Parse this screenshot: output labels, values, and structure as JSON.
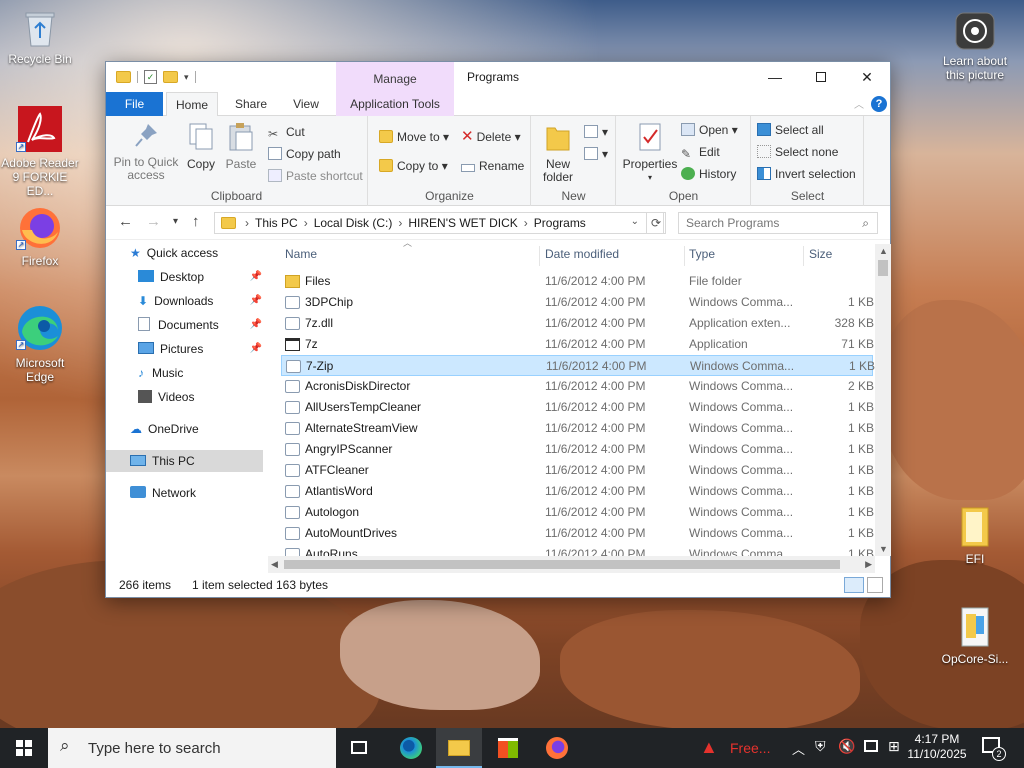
{
  "desktop": {
    "icons_left": [
      {
        "label": "Recycle Bin",
        "icon": "recycle-bin-icon"
      },
      {
        "label": "Adobe Reader 9 FORKIE ED...",
        "icon": "adobe-reader-icon"
      },
      {
        "label": "Firefox",
        "icon": "firefox-icon"
      },
      {
        "label": "Microsoft Edge",
        "icon": "edge-icon"
      }
    ],
    "icons_right": [
      {
        "label": "Learn about this picture",
        "icon": "camera-icon"
      },
      {
        "label": "EFI",
        "icon": "folder-icon"
      },
      {
        "label": "OpCore-Si...",
        "icon": "file-icon"
      }
    ]
  },
  "window": {
    "title": "Programs",
    "context_tab": "Manage",
    "ribbon_tabs": [
      "File",
      "Home",
      "Share",
      "View",
      "Application Tools"
    ],
    "ribbon": {
      "clipboard": {
        "label": "Clipboard",
        "pin": "Pin to Quick access",
        "copy": "Copy",
        "paste": "Paste",
        "cut": "Cut",
        "copy_path": "Copy path",
        "paste_shortcut": "Paste shortcut"
      },
      "organize": {
        "label": "Organize",
        "move_to": "Move to",
        "copy_to": "Copy to",
        "delete": "Delete",
        "rename": "Rename"
      },
      "new": {
        "label": "New",
        "new_folder": "New folder"
      },
      "open": {
        "label": "Open",
        "properties": "Properties",
        "open": "Open",
        "edit": "Edit",
        "history": "History"
      },
      "select": {
        "label": "Select",
        "select_all": "Select all",
        "select_none": "Select none",
        "invert": "Invert selection"
      }
    },
    "breadcrumb": [
      "This PC",
      "Local Disk (C:)",
      "HIREN'S WET DICK",
      "Programs"
    ],
    "search_placeholder": "Search Programs",
    "nav": {
      "quick_access": "Quick access",
      "items": [
        {
          "label": "Desktop",
          "pinned": true
        },
        {
          "label": "Downloads",
          "pinned": true
        },
        {
          "label": "Documents",
          "pinned": true
        },
        {
          "label": "Pictures",
          "pinned": true
        },
        {
          "label": "Music",
          "pinned": false
        },
        {
          "label": "Videos",
          "pinned": false
        }
      ],
      "onedrive": "OneDrive",
      "this_pc": "This PC",
      "network": "Network"
    },
    "columns": {
      "name": "Name",
      "date": "Date modified",
      "type": "Type",
      "size": "Size"
    },
    "files": [
      {
        "name": "Files",
        "date": "11/6/2012 4:00 PM",
        "type": "File folder",
        "size": "",
        "kind": "folder"
      },
      {
        "name": "3DPChip",
        "date": "11/6/2012 4:00 PM",
        "type": "Windows Comma...",
        "size": "1 KB",
        "kind": "cmd"
      },
      {
        "name": "7z.dll",
        "date": "11/6/2012 4:00 PM",
        "type": "Application exten...",
        "size": "328 KB",
        "kind": "dll"
      },
      {
        "name": "7z",
        "date": "11/6/2012 4:00 PM",
        "type": "Application",
        "size": "71 KB",
        "kind": "app"
      },
      {
        "name": "7-Zip",
        "date": "11/6/2012 4:00 PM",
        "type": "Windows Comma...",
        "size": "1 KB",
        "kind": "cmd",
        "selected": true
      },
      {
        "name": "AcronisDiskDirector",
        "date": "11/6/2012 4:00 PM",
        "type": "Windows Comma...",
        "size": "2 KB",
        "kind": "cmd"
      },
      {
        "name": "AllUsersTempCleaner",
        "date": "11/6/2012 4:00 PM",
        "type": "Windows Comma...",
        "size": "1 KB",
        "kind": "cmd"
      },
      {
        "name": "AlternateStreamView",
        "date": "11/6/2012 4:00 PM",
        "type": "Windows Comma...",
        "size": "1 KB",
        "kind": "cmd"
      },
      {
        "name": "AngryIPScanner",
        "date": "11/6/2012 4:00 PM",
        "type": "Windows Comma...",
        "size": "1 KB",
        "kind": "cmd"
      },
      {
        "name": "ATFCleaner",
        "date": "11/6/2012 4:00 PM",
        "type": "Windows Comma...",
        "size": "1 KB",
        "kind": "cmd"
      },
      {
        "name": "AtlantisWord",
        "date": "11/6/2012 4:00 PM",
        "type": "Windows Comma...",
        "size": "1 KB",
        "kind": "cmd"
      },
      {
        "name": "Autologon",
        "date": "11/6/2012 4:00 PM",
        "type": "Windows Comma...",
        "size": "1 KB",
        "kind": "cmd"
      },
      {
        "name": "AutoMountDrives",
        "date": "11/6/2012 4:00 PM",
        "type": "Windows Comma...",
        "size": "1 KB",
        "kind": "cmd"
      },
      {
        "name": "AutoRuns",
        "date": "11/6/2012 4:00 PM",
        "type": "Windows Comma...",
        "size": "1 KB",
        "kind": "cmd"
      }
    ],
    "status": {
      "items": "266 items",
      "selected": "1 item selected",
      "size": "163 bytes"
    }
  },
  "taskbar": {
    "search_placeholder": "Type here to search",
    "app_label": "Free...",
    "time": "4:17 PM",
    "date": "11/10/2025",
    "notifications": "2"
  },
  "colors": {
    "accent": "#1a73d3",
    "selection": "#cce8ff",
    "manage_tab": "#f1dcfb",
    "taskbar": "#202326"
  }
}
